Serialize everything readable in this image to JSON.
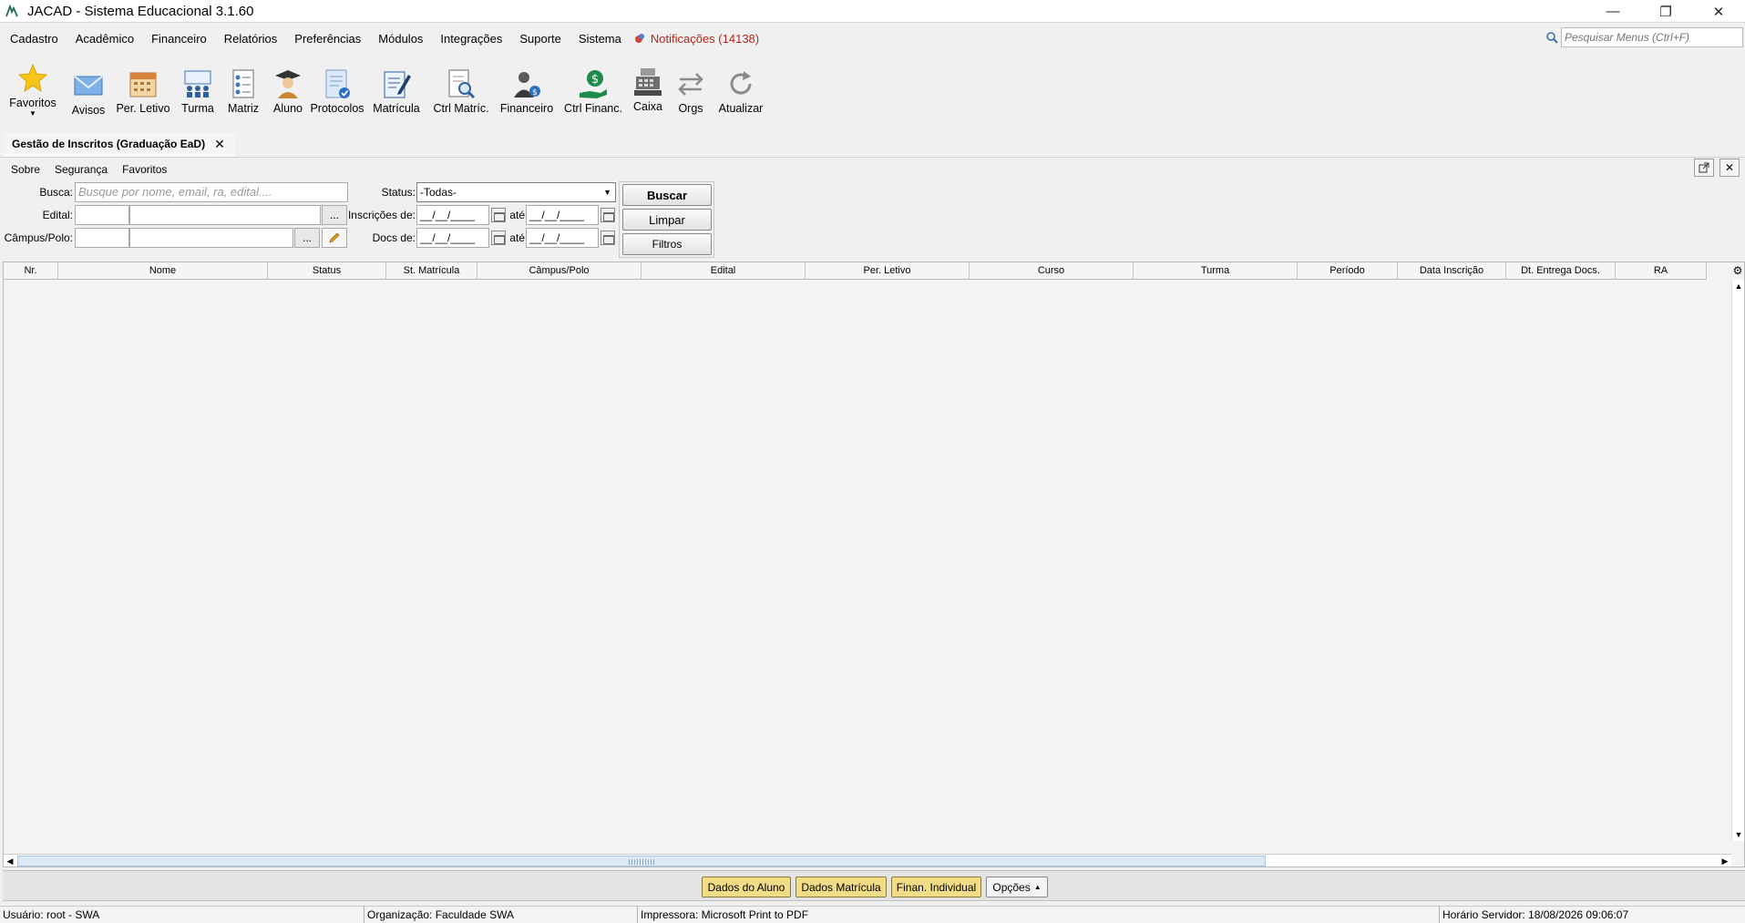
{
  "window": {
    "title": "JACAD - Sistema Educacional 3.1.60"
  },
  "menubar": {
    "items": [
      "Cadastro",
      "Acadêmico",
      "Financeiro",
      "Relatórios",
      "Preferências",
      "Módulos",
      "Integrações",
      "Suporte",
      "Sistema"
    ],
    "notifications": "Notificações (14138)",
    "search_placeholder": "Pesquisar Menus (Ctrl+F)"
  },
  "toolbar": {
    "items": [
      {
        "label": "Favoritos",
        "icon": "star-icon"
      },
      {
        "label": "Avisos",
        "icon": "envelope-icon"
      },
      {
        "label": "Per. Letivo",
        "icon": "calendar-icon"
      },
      {
        "label": "Turma",
        "icon": "class-group-icon"
      },
      {
        "label": "Matriz",
        "icon": "matrix-document-icon"
      },
      {
        "label": "Aluno",
        "icon": "student-icon"
      },
      {
        "label": "Protocolos",
        "icon": "protocol-document-icon"
      },
      {
        "label": "Matrícula",
        "icon": "enrollment-edit-icon"
      },
      {
        "label": "Ctrl Matríc.",
        "icon": "document-search-icon"
      },
      {
        "label": "Financeiro",
        "icon": "finance-person-icon"
      },
      {
        "label": "Ctrl Financ.",
        "icon": "money-hand-icon"
      },
      {
        "label": "Caixa",
        "icon": "cash-register-icon"
      },
      {
        "label": "Orgs",
        "icon": "swap-arrows-icon"
      },
      {
        "label": "Atualizar",
        "icon": "refresh-icon"
      }
    ]
  },
  "tab": {
    "title": "Gestão de Inscritos (Graduação EaD)",
    "close": "✕"
  },
  "submenu": [
    "Sobre",
    "Segurança",
    "Favoritos"
  ],
  "filters": {
    "busca_label": "Busca:",
    "busca_placeholder": "Busque por nome, email, ra, edital....",
    "edital_label": "Edital:",
    "campus_label": "Câmpus/Polo:",
    "status_label": "Status:",
    "status_value": "-Todas-",
    "inscricoes_label": "Inscrições de:",
    "docs_label": "Docs de:",
    "ate_label": "até",
    "date_mask": "__/__/____",
    "ellipsis": "..."
  },
  "buttons": {
    "buscar": "Buscar",
    "limpar": "Limpar",
    "filtros": "Filtros"
  },
  "table": {
    "columns": [
      "Nr.",
      "Nome",
      "Status",
      "St. Matrícula",
      "Câmpus/Polo",
      "Edital",
      "Per. Letivo",
      "Curso",
      "Turma",
      "Período",
      "Data Inscrição",
      "Dt. Entrega Docs.",
      "RA"
    ],
    "rows": []
  },
  "actions": {
    "dados_aluno": "Dados do Aluno",
    "dados_matricula": "Dados Matrícula",
    "finan_individual": "Finan. Individual",
    "opcoes": "Opções"
  },
  "status": {
    "usuario": "Usuário: root - SWA",
    "organizacao": "Organização: Faculdade SWA",
    "impressora": "Impressora: Microsoft Print to PDF",
    "horario": "Horário Servidor: 18/08/2026 09:06:07"
  },
  "colors": {
    "notification": "#b3261e",
    "action_button": "#f3dc87",
    "scroll_thumb": "#dbe9f7"
  }
}
